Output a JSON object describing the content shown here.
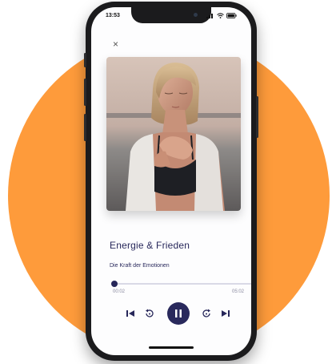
{
  "status": {
    "time": "13:53"
  },
  "close_label": "×",
  "track": {
    "title": "Energie & Frieden",
    "subtitle": "Die Kraft der Emotionen",
    "elapsed": "00:02",
    "duration": "05:02",
    "progress": 0.01
  },
  "icons": {
    "close": "close-icon",
    "previous": "skip-previous-icon",
    "rewind": "rewind-icon",
    "pause": "pause-icon",
    "forward": "forward-icon",
    "next": "skip-next-icon"
  },
  "colors": {
    "background_circle": "#fe9b3b",
    "accent": "#27275a",
    "phone": "#1b1b1d"
  }
}
